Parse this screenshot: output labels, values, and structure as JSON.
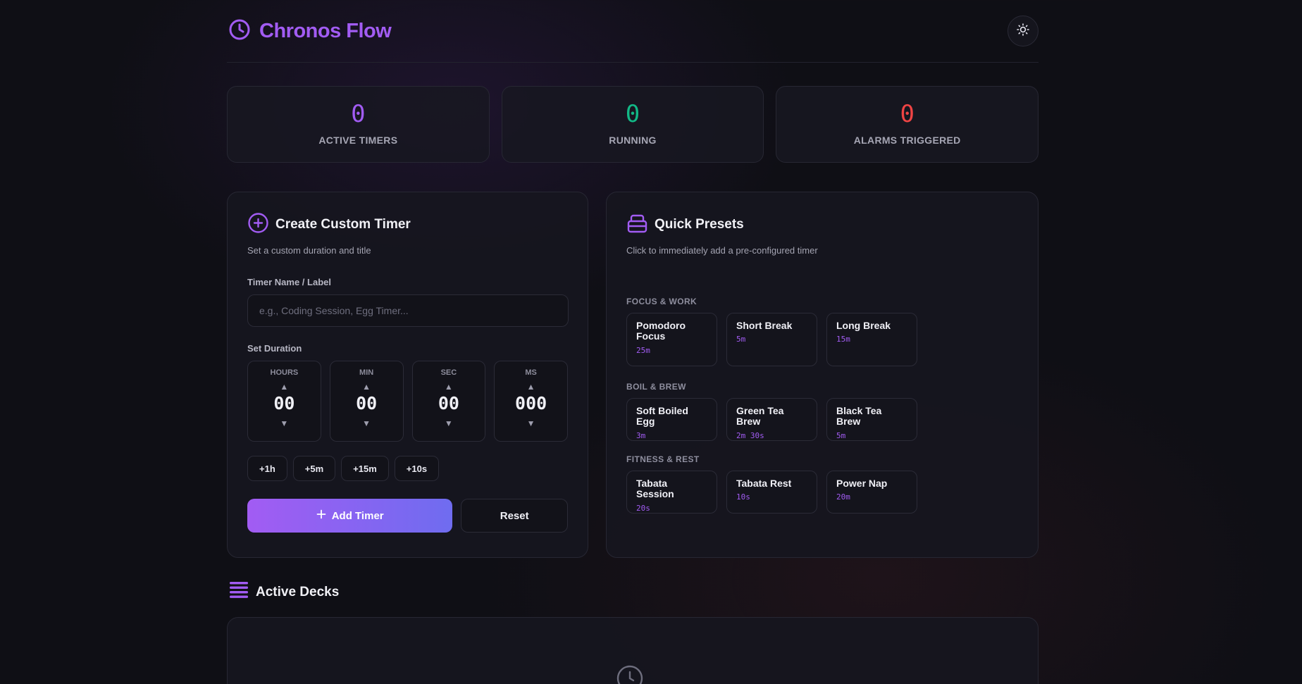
{
  "app": {
    "title": "Chronos Flow",
    "theme_icon": "sun-icon"
  },
  "stats": [
    {
      "value": "0",
      "label": "ACTIVE TIMERS",
      "color": "#a25cf3"
    },
    {
      "value": "0",
      "label": "RUNNING",
      "color": "#12b886"
    },
    {
      "value": "0",
      "label": "ALARMS TRIGGERED",
      "color": "#ef4444"
    }
  ],
  "create": {
    "title": "Create Custom Timer",
    "subtitle": "Set a custom duration and title",
    "name_label": "Timer Name / Label",
    "name_placeholder": "e.g., Coding Session, Egg Timer...",
    "duration_label": "Set Duration",
    "fields": [
      {
        "name": "HOURS",
        "value": "00"
      },
      {
        "name": "MIN",
        "value": "00"
      },
      {
        "name": "SEC",
        "value": "00"
      },
      {
        "name": "MS",
        "value": "000"
      }
    ],
    "quick_add": [
      "+1h",
      "+5m",
      "+15m",
      "+10s"
    ],
    "add_label": "Add Timer",
    "reset_label": "Reset"
  },
  "presets": {
    "title": "Quick Presets",
    "subtitle": "Click to immediately add a pre-configured timer",
    "groups": [
      {
        "title": "FOCUS & WORK",
        "items": [
          {
            "name": "Pomodoro Focus",
            "time": "25m"
          },
          {
            "name": "Short Break",
            "time": "5m"
          },
          {
            "name": "Long Break",
            "time": "15m"
          }
        ]
      },
      {
        "title": "BOIL & BREW",
        "items": [
          {
            "name": "Soft Boiled Egg",
            "time": "3m"
          },
          {
            "name": "Green Tea Brew",
            "time": "2m 30s"
          },
          {
            "name": "Black Tea Brew",
            "time": "5m"
          }
        ]
      },
      {
        "title": "FITNESS & REST",
        "items": [
          {
            "name": "Tabata Session",
            "time": "20s"
          },
          {
            "name": "Tabata Rest",
            "time": "10s"
          },
          {
            "name": "Power Nap",
            "time": "20m"
          }
        ]
      }
    ]
  },
  "decks": {
    "title": "Active Decks"
  }
}
